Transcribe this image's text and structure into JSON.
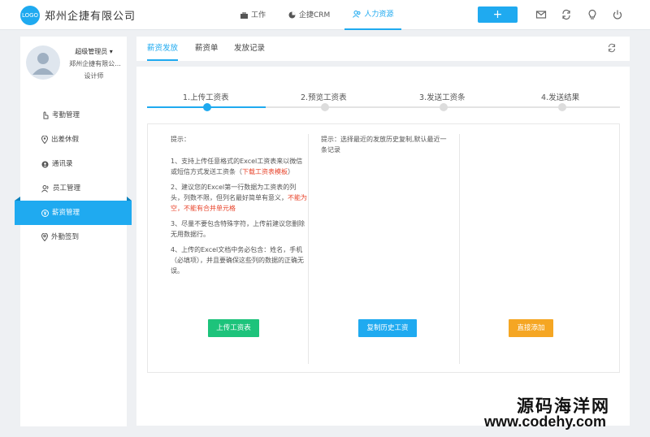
{
  "header": {
    "logo_text": "LOGO",
    "company_name": "郑州企捷有限公司",
    "nav": [
      {
        "label": "工作",
        "icon": "briefcase-icon"
      },
      {
        "label": "企捷CRM",
        "icon": "pie-chart-icon"
      },
      {
        "label": "人力资源",
        "icon": "users-icon",
        "active": true
      }
    ],
    "plus_label": "+",
    "icons": [
      "mail-icon",
      "sync-icon",
      "lightbulb-icon",
      "power-icon"
    ]
  },
  "user": {
    "role": "超级管理员",
    "company": "郑州企捷有限公...",
    "title": "设计师"
  },
  "menu": [
    {
      "label": "考勤管理",
      "icon": "hand-icon"
    },
    {
      "label": "出差休假",
      "icon": "location-pin-icon"
    },
    {
      "label": "通讯录",
      "icon": "contact-icon"
    },
    {
      "label": "员工管理",
      "icon": "user-icon"
    },
    {
      "label": "薪资管理",
      "icon": "money-icon",
      "active": true
    },
    {
      "label": "外勤签到",
      "icon": "map-pin-icon"
    }
  ],
  "tabs": [
    {
      "label": "薪资发放",
      "active": true
    },
    {
      "label": "薪资单"
    },
    {
      "label": "发放记录"
    }
  ],
  "steps": [
    {
      "label": "1.上传工资表",
      "active": true
    },
    {
      "label": "2.预览工资表"
    },
    {
      "label": "3.发送工资条"
    },
    {
      "label": "4.发送结果"
    }
  ],
  "tips": {
    "head": "提示：",
    "item1_text": "1、支持上传任意格式的Excel工资表来以微信或短信方式发送工资条（",
    "item1_link": "下载工资表模板",
    "item1_end": "）",
    "item2_text": "2、建议您的Excel第一行数据为工资表的列头，列数不限，但列名最好简单有意义，",
    "item2_red": "不能为空，不能有合并单元格",
    "item3_text": "3、尽量不要包含特殊字符，上传前建议您删除无用数据行。",
    "item4_text": "4、上传的Excel文档中务必包含：姓名，手机（必填项），并且要确保这些列的数据的正确无误。"
  },
  "tips2": "提示：选择最近的发放历史复制,默认最近一条记录",
  "buttons": {
    "upload": "上传工资表",
    "copy_history": "复制历史工资",
    "direct_add": "直接添加"
  },
  "watermark": {
    "cn": "源码海洋网",
    "url": "www.codehy.com"
  }
}
